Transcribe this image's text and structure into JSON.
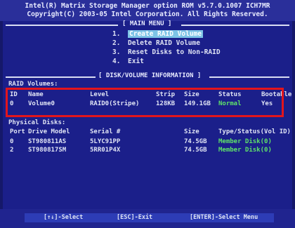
{
  "header": {
    "line1": "Intel(R) Matrix Storage Manager option ROM v5.7.0.1007 ICH7MR",
    "line2": "Copyright(C) 2003-05 Intel Corporation.  All Rights Reserved."
  },
  "main_menu": {
    "title": "[ MAIN MENU ]",
    "items": [
      {
        "num": "1.",
        "label": "Create RAID Volume",
        "selected": true
      },
      {
        "num": "2.",
        "label": "Delete RAID Volume",
        "selected": false
      },
      {
        "num": "3.",
        "label": "Reset Disks to Non-RAID",
        "selected": false
      },
      {
        "num": "4.",
        "label": "Exit",
        "selected": false
      }
    ]
  },
  "info": {
    "title": "[ DISK/VOLUME INFORMATION ]",
    "raid_heading": "RAID Volumes:",
    "raid_columns": {
      "id": "ID",
      "name": "Name",
      "level": "Level",
      "strip": "Strip",
      "size": "Size",
      "status": "Status",
      "bootable": "Bootable"
    },
    "raid_rows": [
      {
        "id": "0",
        "name": "Volume0",
        "level": "RAID0(Stripe)",
        "strip": "128KB",
        "size": "149.1GB",
        "status": "Normal",
        "bootable": "Yes"
      }
    ],
    "physical_heading": "Physical Disks:",
    "disk_columns": {
      "port": "Port",
      "model": "Drive Model",
      "serial": "Serial #",
      "size": "Size",
      "type": "Type/Status(Vol ID)"
    },
    "disk_rows": [
      {
        "port": "0",
        "model": "ST980811AS",
        "serial": "5LYC91PP",
        "size": "74.5GB",
        "type": "Member Disk(0)"
      },
      {
        "port": "2",
        "model": "ST980817SM",
        "serial": "5RR01P4X",
        "size": "74.5GB",
        "type": "Member Disk(0)"
      }
    ]
  },
  "footer": {
    "select": "[↑↓]-Select",
    "exit": "[ESC]-Exit",
    "enter": "[ENTER]-Select Menu"
  },
  "colors": {
    "background": "#1b1f8a",
    "text": "#dfe3f4",
    "status_green": "#5fe36a",
    "selection": "#7dc3e6",
    "annotation_red": "#e3151c"
  }
}
